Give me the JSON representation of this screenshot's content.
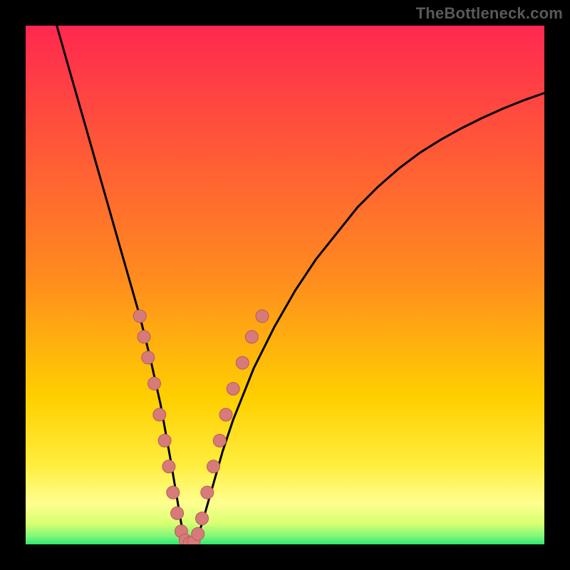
{
  "watermark": "TheBottleneck.com",
  "colors": {
    "frame": "#000000",
    "watermark": "#595959",
    "gradient_top": "#ff2850",
    "gradient_mid": "#ffd000",
    "gradient_low": "#ffff70",
    "gradient_base": "#2ee86f",
    "curve": "#000000",
    "dot_fill": "#d77a7a",
    "dot_stroke": "#b85a5a"
  },
  "chart_data": {
    "type": "line",
    "title": "",
    "xlabel": "",
    "ylabel": "",
    "xlim": [
      0,
      100
    ],
    "ylim": [
      0,
      100
    ],
    "series": [
      {
        "name": "bottleneck-curve",
        "x": [
          6,
          8,
          10,
          12,
          14,
          16,
          18,
          20,
          22,
          24,
          26,
          28,
          29,
          30,
          31,
          32,
          33,
          34,
          36,
          38,
          40,
          44,
          48,
          52,
          56,
          60,
          64,
          68,
          72,
          76,
          80,
          84,
          88,
          92,
          96,
          100
        ],
        "y": [
          100,
          93,
          86,
          79,
          72,
          65,
          58,
          51,
          44,
          36,
          27,
          16,
          10,
          4,
          1,
          0,
          1,
          4,
          11,
          18,
          24,
          34,
          42,
          49,
          55,
          60,
          65,
          69,
          72.5,
          75.5,
          78,
          80.2,
          82.2,
          84,
          85.6,
          87
        ]
      }
    ],
    "dots": [
      {
        "x": 22.0,
        "y": 44
      },
      {
        "x": 22.8,
        "y": 40
      },
      {
        "x": 23.6,
        "y": 36
      },
      {
        "x": 24.8,
        "y": 31
      },
      {
        "x": 25.8,
        "y": 25
      },
      {
        "x": 26.8,
        "y": 20
      },
      {
        "x": 27.6,
        "y": 15
      },
      {
        "x": 28.4,
        "y": 10
      },
      {
        "x": 29.2,
        "y": 6
      },
      {
        "x": 30.0,
        "y": 2.5
      },
      {
        "x": 30.8,
        "y": 0.8
      },
      {
        "x": 31.6,
        "y": 0.2
      },
      {
        "x": 32.4,
        "y": 0.5
      },
      {
        "x": 33.2,
        "y": 2
      },
      {
        "x": 34.0,
        "y": 5
      },
      {
        "x": 35.0,
        "y": 10
      },
      {
        "x": 36.2,
        "y": 15
      },
      {
        "x": 37.4,
        "y": 20
      },
      {
        "x": 38.6,
        "y": 25
      },
      {
        "x": 40.0,
        "y": 30
      },
      {
        "x": 41.8,
        "y": 35
      },
      {
        "x": 43.6,
        "y": 40
      },
      {
        "x": 45.6,
        "y": 44
      }
    ],
    "gradient_stops": [
      {
        "offset": 0,
        "label": "top",
        "meaning": "high-bottleneck"
      },
      {
        "offset": 72,
        "label": "mid"
      },
      {
        "offset": 90,
        "label": "low"
      },
      {
        "offset": 100,
        "label": "base",
        "meaning": "no-bottleneck"
      }
    ]
  }
}
